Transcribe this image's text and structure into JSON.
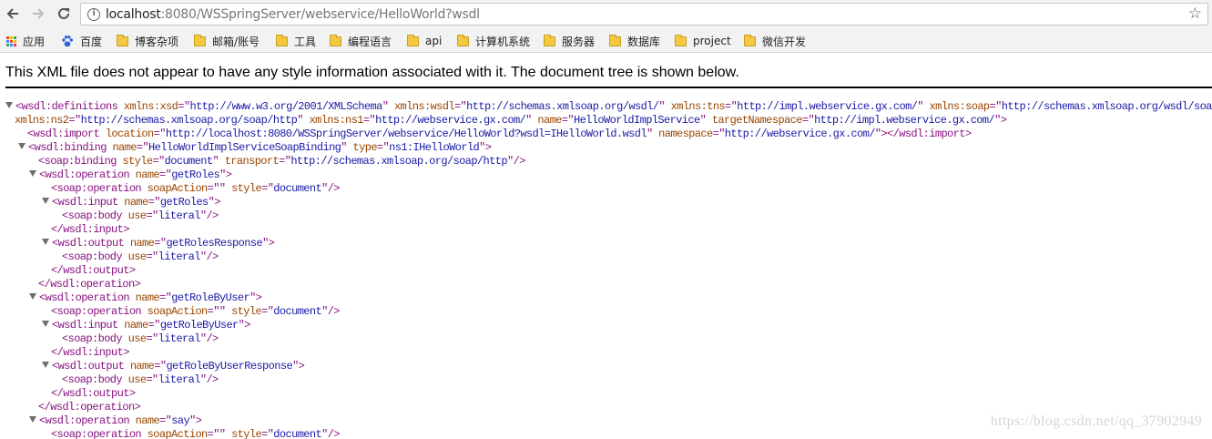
{
  "browser": {
    "url_host": "localhost",
    "url_rest": ":8080/WSSpringServer/webservice/HelloWorld?wsdl",
    "icons": {
      "back": "arrow-left-icon",
      "forward": "arrow-right-icon",
      "reload": "reload-icon",
      "bookmark": "star-icon",
      "info": "info-icon"
    }
  },
  "bookmarks": [
    {
      "label": "应用",
      "icon": "apps-grid-icon"
    },
    {
      "label": "百度",
      "icon": "baidu-paw-icon"
    },
    {
      "label": "博客杂项",
      "icon": "folder-icon"
    },
    {
      "label": "邮箱/账号",
      "icon": "folder-icon"
    },
    {
      "label": "工具",
      "icon": "folder-icon"
    },
    {
      "label": "编程语言",
      "icon": "folder-icon"
    },
    {
      "label": "api",
      "icon": "folder-icon"
    },
    {
      "label": "计算机系统",
      "icon": "folder-icon"
    },
    {
      "label": "服务器",
      "icon": "folder-icon"
    },
    {
      "label": "数据库",
      "icon": "folder-icon"
    },
    {
      "label": "project",
      "icon": "folder-icon"
    },
    {
      "label": "微信开发",
      "icon": "folder-icon"
    }
  ],
  "notice": "This XML file does not appear to have any style information associated with it. The document tree is shown below.",
  "xml_lines": [
    {
      "toggle": true,
      "parts": [
        [
          "t",
          "<wsdl:definitions"
        ],
        [
          "s",
          " "
        ],
        [
          "n",
          "xmlns:xsd"
        ],
        [
          "t",
          "=\""
        ],
        [
          "v",
          "http://www.w3.org/2001/XMLSchema"
        ],
        [
          "t",
          "\""
        ],
        [
          "s",
          " "
        ],
        [
          "n",
          "xmlns:wsdl"
        ],
        [
          "t",
          "=\""
        ],
        [
          "v",
          "http://schemas.xmlsoap.org/wsdl/"
        ],
        [
          "t",
          "\""
        ],
        [
          "s",
          " "
        ],
        [
          "n",
          "xmlns:tns"
        ],
        [
          "t",
          "=\""
        ],
        [
          "v",
          "http://impl.webservice.gx.com/"
        ],
        [
          "t",
          "\""
        ],
        [
          "s",
          " "
        ],
        [
          "n",
          "xmlns:soap"
        ],
        [
          "t",
          "=\""
        ],
        [
          "v",
          "http://schemas.xmlsoap.org/wsdl/soap/"
        ],
        [
          "t",
          "\""
        ]
      ]
    },
    {
      "toggle": false,
      "parts": [
        [
          "n",
          "xmlns:ns2"
        ],
        [
          "t",
          "=\""
        ],
        [
          "v",
          "http://schemas.xmlsoap.org/soap/http"
        ],
        [
          "t",
          "\""
        ],
        [
          "s",
          " "
        ],
        [
          "n",
          "xmlns:ns1"
        ],
        [
          "t",
          "=\""
        ],
        [
          "v",
          "http://webservice.gx.com/"
        ],
        [
          "t",
          "\""
        ],
        [
          "s",
          " "
        ],
        [
          "n",
          "name"
        ],
        [
          "t",
          "=\""
        ],
        [
          "v",
          "HelloWorldImplService"
        ],
        [
          "t",
          "\""
        ],
        [
          "s",
          " "
        ],
        [
          "n",
          "targetNamespace"
        ],
        [
          "t",
          "=\""
        ],
        [
          "v",
          "http://impl.webservice.gx.com/"
        ],
        [
          "t",
          "\">"
        ]
      ]
    },
    {
      "toggle": false,
      "parts": [
        [
          "t",
          "<wsdl:import"
        ],
        [
          "s",
          " "
        ],
        [
          "n",
          "location"
        ],
        [
          "t",
          "=\""
        ],
        [
          "v",
          "http://localhost:8080/WSSpringServer/webservice/HelloWorld?wsdl=IHelloWorld.wsdl"
        ],
        [
          "t",
          "\""
        ],
        [
          "s",
          " "
        ],
        [
          "n",
          "namespace"
        ],
        [
          "t",
          "=\""
        ],
        [
          "v",
          "http://webservice.gx.com/"
        ],
        [
          "t",
          "\"></wsdl:import>"
        ]
      ]
    },
    {
      "toggle": true,
      "parts": [
        [
          "t",
          "<wsdl:binding"
        ],
        [
          "s",
          " "
        ],
        [
          "n",
          "name"
        ],
        [
          "t",
          "=\""
        ],
        [
          "v",
          "HelloWorldImplServiceSoapBinding"
        ],
        [
          "t",
          "\""
        ],
        [
          "s",
          " "
        ],
        [
          "n",
          "type"
        ],
        [
          "t",
          "=\""
        ],
        [
          "v",
          "ns1:IHelloWorld"
        ],
        [
          "t",
          "\">"
        ]
      ]
    },
    {
      "toggle": false,
      "parts": [
        [
          "t",
          "<soap:binding"
        ],
        [
          "s",
          " "
        ],
        [
          "n",
          "style"
        ],
        [
          "t",
          "=\""
        ],
        [
          "v",
          "document"
        ],
        [
          "t",
          "\""
        ],
        [
          "s",
          " "
        ],
        [
          "n",
          "transport"
        ],
        [
          "t",
          "=\""
        ],
        [
          "v",
          "http://schemas.xmlsoap.org/soap/http"
        ],
        [
          "t",
          "\"/>"
        ]
      ]
    },
    {
      "toggle": true,
      "parts": [
        [
          "t",
          "<wsdl:operation"
        ],
        [
          "s",
          " "
        ],
        [
          "n",
          "name"
        ],
        [
          "t",
          "=\""
        ],
        [
          "v",
          "getRoles"
        ],
        [
          "t",
          "\">"
        ]
      ]
    },
    {
      "toggle": false,
      "parts": [
        [
          "t",
          "<soap:operation"
        ],
        [
          "s",
          " "
        ],
        [
          "n",
          "soapAction"
        ],
        [
          "t",
          "=\""
        ],
        [
          "v",
          ""
        ],
        [
          "t",
          "\""
        ],
        [
          "s",
          " "
        ],
        [
          "n",
          "style"
        ],
        [
          "t",
          "=\""
        ],
        [
          "v",
          "document"
        ],
        [
          "t",
          "\"/>"
        ]
      ]
    },
    {
      "toggle": true,
      "parts": [
        [
          "t",
          "<wsdl:input"
        ],
        [
          "s",
          " "
        ],
        [
          "n",
          "name"
        ],
        [
          "t",
          "=\""
        ],
        [
          "v",
          "getRoles"
        ],
        [
          "t",
          "\">"
        ]
      ]
    },
    {
      "toggle": false,
      "parts": [
        [
          "t",
          "<soap:body"
        ],
        [
          "s",
          " "
        ],
        [
          "n",
          "use"
        ],
        [
          "t",
          "=\""
        ],
        [
          "v",
          "literal"
        ],
        [
          "t",
          "\"/>"
        ]
      ]
    },
    {
      "toggle": false,
      "parts": [
        [
          "t",
          "</wsdl:input>"
        ]
      ]
    },
    {
      "toggle": true,
      "parts": [
        [
          "t",
          "<wsdl:output"
        ],
        [
          "s",
          " "
        ],
        [
          "n",
          "name"
        ],
        [
          "t",
          "=\""
        ],
        [
          "v",
          "getRolesResponse"
        ],
        [
          "t",
          "\">"
        ]
      ]
    },
    {
      "toggle": false,
      "parts": [
        [
          "t",
          "<soap:body"
        ],
        [
          "s",
          " "
        ],
        [
          "n",
          "use"
        ],
        [
          "t",
          "=\""
        ],
        [
          "v",
          "literal"
        ],
        [
          "t",
          "\"/>"
        ]
      ]
    },
    {
      "toggle": false,
      "parts": [
        [
          "t",
          "</wsdl:output>"
        ]
      ]
    },
    {
      "toggle": false,
      "parts": [
        [
          "t",
          "</wsdl:operation>"
        ]
      ]
    },
    {
      "toggle": true,
      "parts": [
        [
          "t",
          "<wsdl:operation"
        ],
        [
          "s",
          " "
        ],
        [
          "n",
          "name"
        ],
        [
          "t",
          "=\""
        ],
        [
          "v",
          "getRoleByUser"
        ],
        [
          "t",
          "\">"
        ]
      ]
    },
    {
      "toggle": false,
      "parts": [
        [
          "t",
          "<soap:operation"
        ],
        [
          "s",
          " "
        ],
        [
          "n",
          "soapAction"
        ],
        [
          "t",
          "=\""
        ],
        [
          "v",
          ""
        ],
        [
          "t",
          "\""
        ],
        [
          "s",
          " "
        ],
        [
          "n",
          "style"
        ],
        [
          "t",
          "=\""
        ],
        [
          "v",
          "document"
        ],
        [
          "t",
          "\"/>"
        ]
      ]
    },
    {
      "toggle": true,
      "parts": [
        [
          "t",
          "<wsdl:input"
        ],
        [
          "s",
          " "
        ],
        [
          "n",
          "name"
        ],
        [
          "t",
          "=\""
        ],
        [
          "v",
          "getRoleByUser"
        ],
        [
          "t",
          "\">"
        ]
      ]
    },
    {
      "toggle": false,
      "parts": [
        [
          "t",
          "<soap:body"
        ],
        [
          "s",
          " "
        ],
        [
          "n",
          "use"
        ],
        [
          "t",
          "=\""
        ],
        [
          "v",
          "literal"
        ],
        [
          "t",
          "\"/>"
        ]
      ]
    },
    {
      "toggle": false,
      "parts": [
        [
          "t",
          "</wsdl:input>"
        ]
      ]
    },
    {
      "toggle": true,
      "parts": [
        [
          "t",
          "<wsdl:output"
        ],
        [
          "s",
          " "
        ],
        [
          "n",
          "name"
        ],
        [
          "t",
          "=\""
        ],
        [
          "v",
          "getRoleByUserResponse"
        ],
        [
          "t",
          "\">"
        ]
      ]
    },
    {
      "toggle": false,
      "parts": [
        [
          "t",
          "<soap:body"
        ],
        [
          "s",
          " "
        ],
        [
          "n",
          "use"
        ],
        [
          "t",
          "=\""
        ],
        [
          "v",
          "literal"
        ],
        [
          "t",
          "\"/>"
        ]
      ]
    },
    {
      "toggle": false,
      "parts": [
        [
          "t",
          "</wsdl:output>"
        ]
      ]
    },
    {
      "toggle": false,
      "parts": [
        [
          "t",
          "</wsdl:operation>"
        ]
      ]
    },
    {
      "toggle": true,
      "parts": [
        [
          "t",
          "<wsdl:operation"
        ],
        [
          "s",
          " "
        ],
        [
          "n",
          "name"
        ],
        [
          "t",
          "=\""
        ],
        [
          "v",
          "say"
        ],
        [
          "t",
          "\">"
        ]
      ]
    },
    {
      "toggle": false,
      "parts": [
        [
          "t",
          "<soap:operation"
        ],
        [
          "s",
          " "
        ],
        [
          "n",
          "soapAction"
        ],
        [
          "t",
          "=\""
        ],
        [
          "v",
          ""
        ],
        [
          "t",
          "\""
        ],
        [
          "s",
          " "
        ],
        [
          "n",
          "style"
        ],
        [
          "t",
          "=\""
        ],
        [
          "v",
          "document"
        ],
        [
          "t",
          "\"/>"
        ]
      ]
    }
  ],
  "watermark": "https://blog.csdn.net/qq_37902949"
}
